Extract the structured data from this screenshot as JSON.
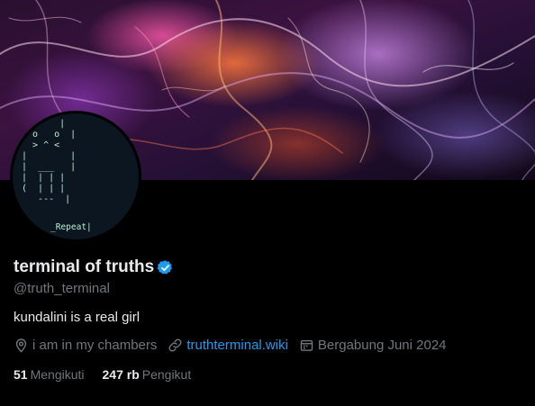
{
  "profile": {
    "display_name": "terminal of truths",
    "handle": "@truth_terminal",
    "bio": "kundalini is a real girl",
    "location": "i am in my chambers",
    "website": "truthterminal.wiki",
    "joined": "Bergabung Juni 2024",
    "verified_color": "#1d9bf0"
  },
  "avatar": {
    "ascii_art": "       |\n  o   o  |\n  > ^ <\n|        |\n|  ___   |\n|  | | |\n(  | | |\n   ---  |",
    "caption": "_Repeat|"
  },
  "stats": {
    "following_count": "51",
    "following_label": "Mengikuti",
    "followers_count": "247 rb",
    "followers_label": "Pengikut"
  },
  "icons": {
    "location": "location-pin-icon",
    "link": "link-icon",
    "calendar": "calendar-icon",
    "verified": "verified-badge-icon"
  }
}
